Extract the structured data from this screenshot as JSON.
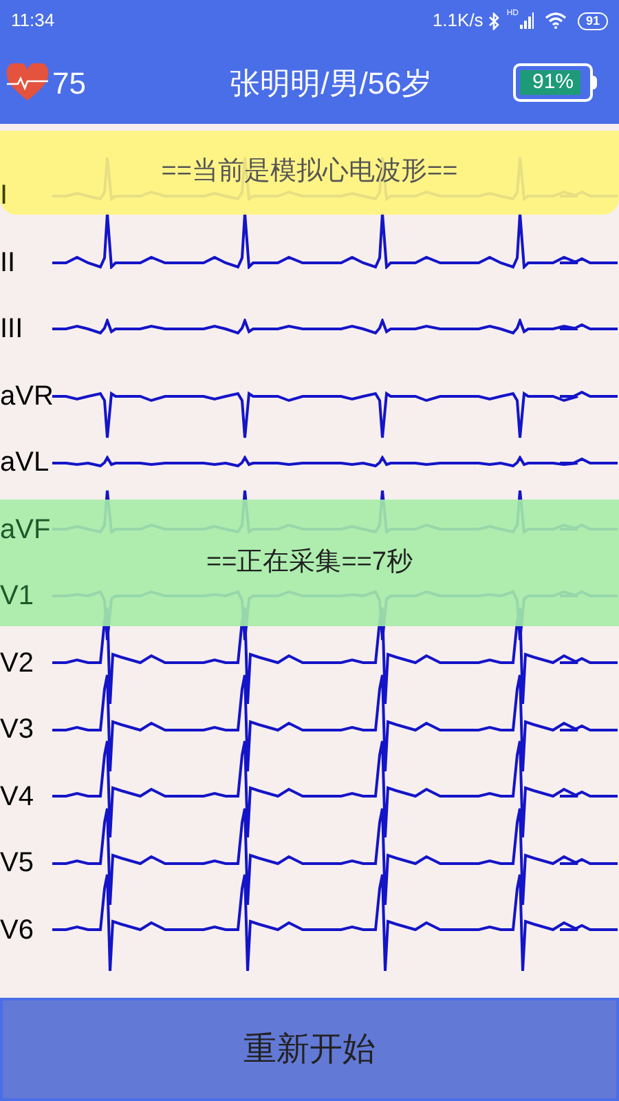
{
  "status_bar": {
    "time": "11:34",
    "net_speed": "1.1K/s",
    "signal_tag": "HD",
    "battery": "91"
  },
  "header": {
    "heart_rate": "75",
    "patient": "张明明/男/56岁",
    "battery": {
      "label": "91%",
      "level": 0.91
    }
  },
  "leads": [
    {
      "label": "I",
      "kind": "upright"
    },
    {
      "label": "II",
      "kind": "tall"
    },
    {
      "label": "III",
      "kind": "small"
    },
    {
      "label": "aVR",
      "kind": "inverted"
    },
    {
      "label": "aVL",
      "kind": "flat"
    },
    {
      "label": "aVF",
      "kind": "upright"
    },
    {
      "label": "V1",
      "kind": "deep"
    },
    {
      "label": "V2",
      "kind": "biphasic"
    },
    {
      "label": "V3",
      "kind": "biphasic"
    },
    {
      "label": "V4",
      "kind": "biphasic"
    },
    {
      "label": "V5",
      "kind": "biphasic"
    },
    {
      "label": "V6",
      "kind": "biphasic"
    }
  ],
  "notices": [
    {
      "text": "==当前是模拟心电波形==",
      "kind": "warning"
    },
    {
      "text": "==正在采集==7秒",
      "kind": "progress"
    }
  ],
  "restart_button": "重新开始"
}
